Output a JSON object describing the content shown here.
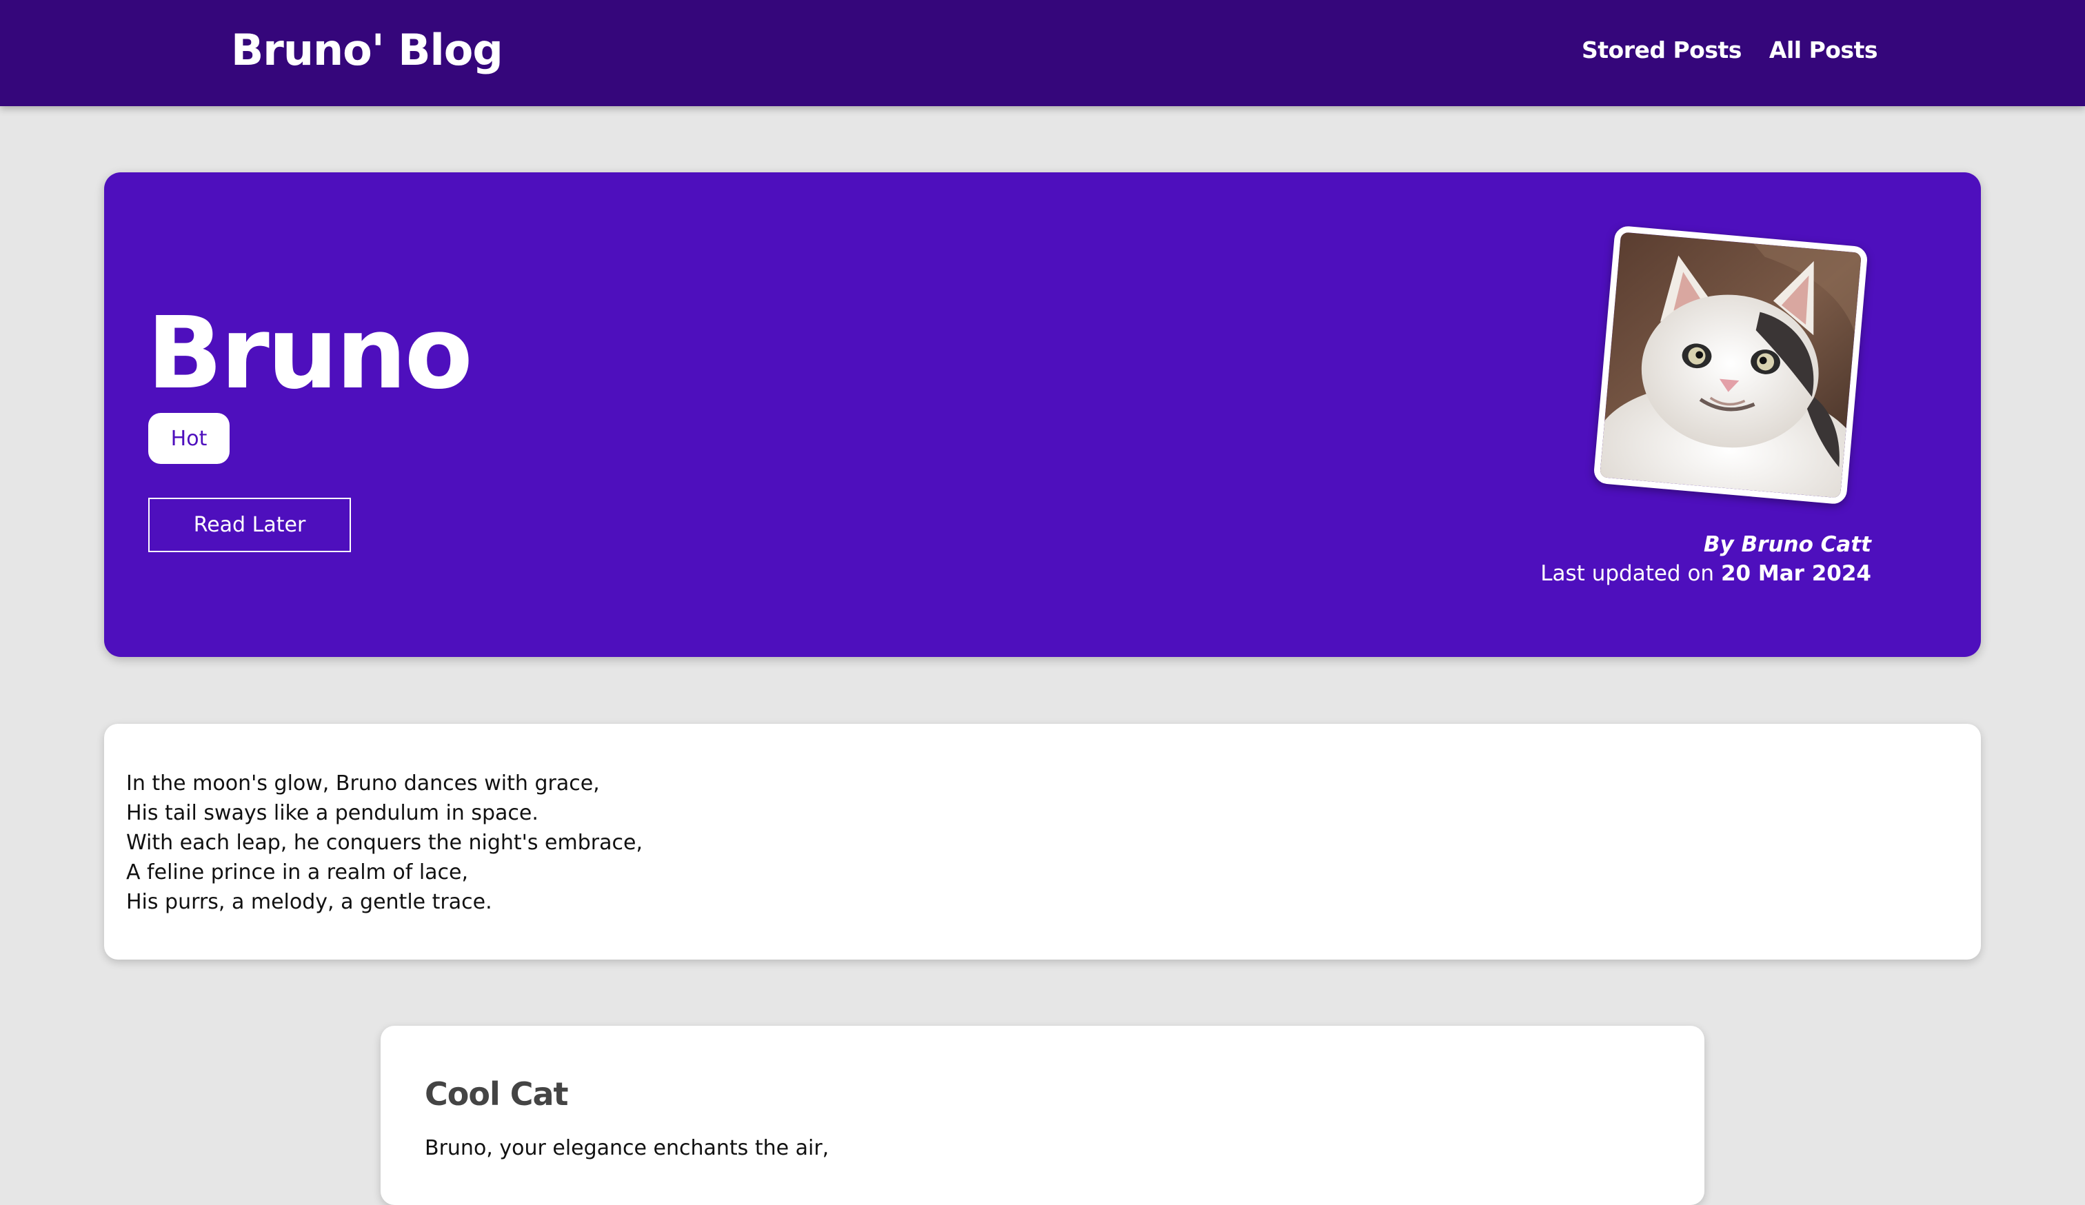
{
  "navbar": {
    "brand": "Bruno' Blog",
    "links": [
      "Stored Posts",
      "All Posts"
    ]
  },
  "hero": {
    "title": "Bruno",
    "tag": "Hot",
    "read_later_label": "Read Later",
    "author": "By Bruno Catt",
    "updated_prefix": "Last updated on",
    "updated_date": "20 Mar 2024",
    "image_subject": "smiling white cat photo"
  },
  "content": {
    "lines": [
      "In the moon's glow, Bruno dances with grace,",
      "His tail sways like a pendulum in space.",
      "With each leap, he conquers the night's embrace,",
      "A feline prince in a realm of lace,",
      "His purrs, a melody, a gentle trace."
    ]
  },
  "related": {
    "title": "Cool Cat",
    "text": "Bruno, your elegance enchants the air,"
  },
  "colors": {
    "navbar": "#35067b",
    "hero": "#4e0fbd",
    "background": "#e6e6e6",
    "card": "#ffffff"
  }
}
